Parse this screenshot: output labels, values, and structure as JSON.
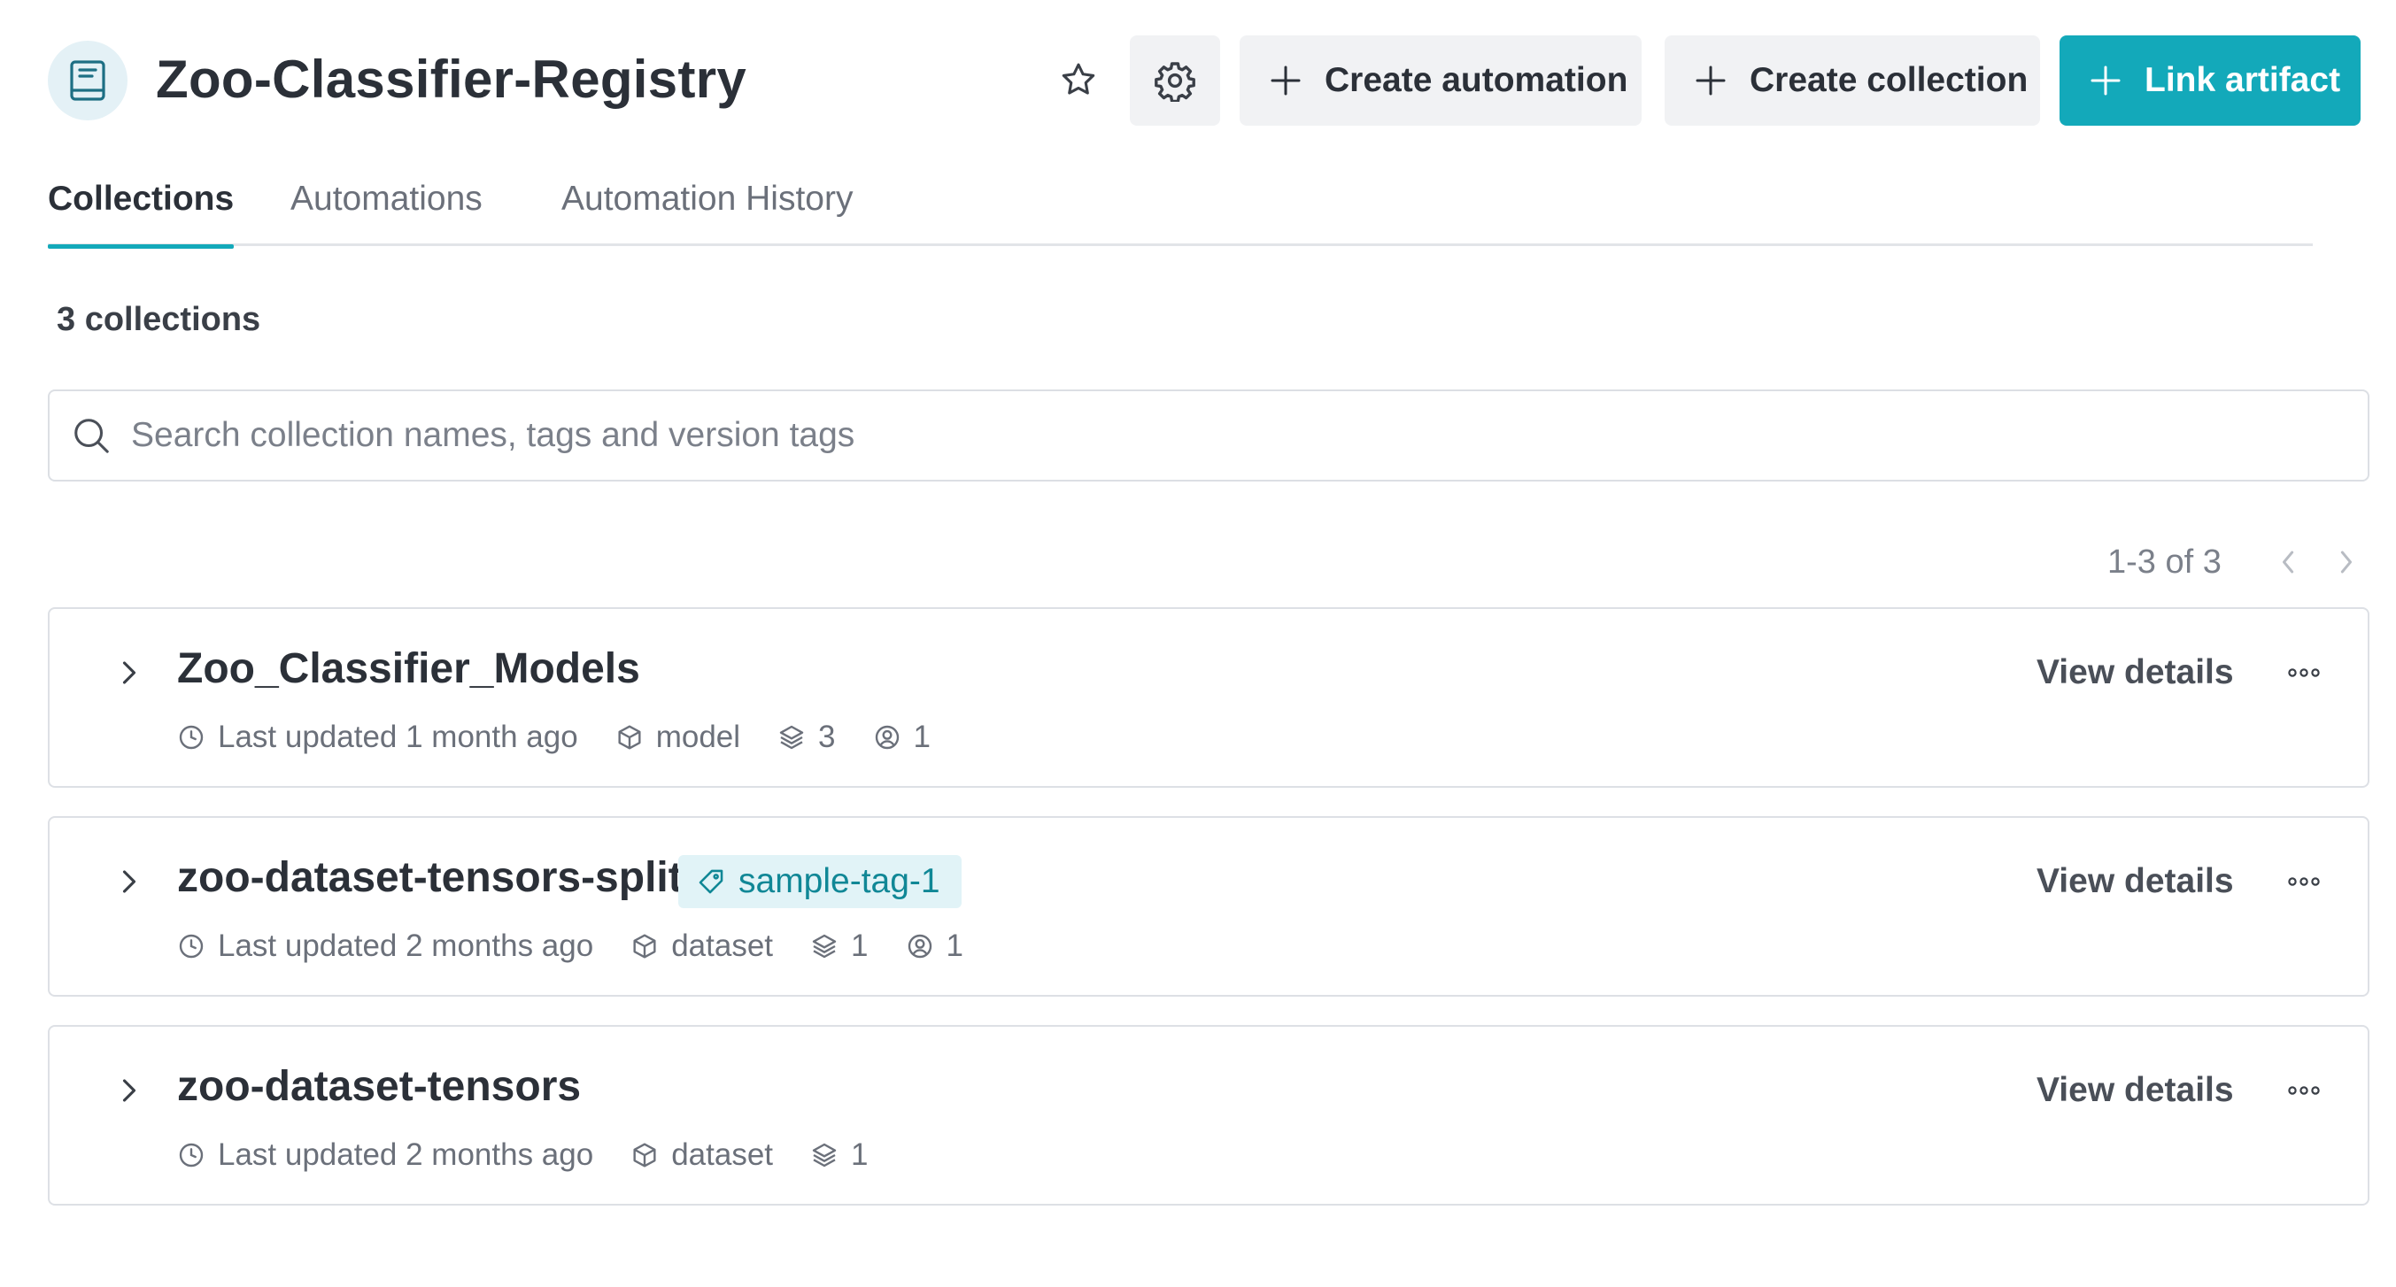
{
  "header": {
    "title": "Zoo-Classifier-Registry",
    "create_automation_label": "Create automation",
    "create_collection_label": "Create collection",
    "link_artifact_label": "Link artifact"
  },
  "tabs": [
    {
      "label": "Collections",
      "active": true
    },
    {
      "label": "Automations",
      "active": false
    },
    {
      "label": "Automation History",
      "active": false
    }
  ],
  "count_label": "3 collections",
  "search": {
    "placeholder": "Search collection names, tags and version tags",
    "value": ""
  },
  "pagination": {
    "label": "1-3 of 3"
  },
  "collections": [
    {
      "name": "Zoo_Classifier_Models",
      "tag": null,
      "updated": "Last updated 1 month ago",
      "type": "model",
      "versions": "3",
      "users": "1",
      "view_label": "View details"
    },
    {
      "name": "zoo-dataset-tensors-split",
      "tag": "sample-tag-1",
      "updated": "Last updated 2 months ago",
      "type": "dataset",
      "versions": "1",
      "users": "1",
      "view_label": "View details"
    },
    {
      "name": "zoo-dataset-tensors",
      "tag": null,
      "updated": "Last updated 2 months ago",
      "type": "dataset",
      "versions": "1",
      "view_label": "View details"
    }
  ],
  "colors": {
    "accent": "#13a9ba",
    "tag_bg": "#e1f3f7",
    "tag_text": "#108796",
    "button_bg": "#f1f2f4",
    "border": "#dde0e5"
  },
  "icons": {
    "registry": "book-icon",
    "star": "star-icon",
    "settings": "gear-icon",
    "add": "plus-icon",
    "search": "search-icon",
    "expand": "chevron-right-icon",
    "updated": "clock-icon",
    "type": "box-icon",
    "versions": "layers-icon",
    "users": "user-circle-icon",
    "more": "more-icon",
    "tag": "tag-icon"
  }
}
